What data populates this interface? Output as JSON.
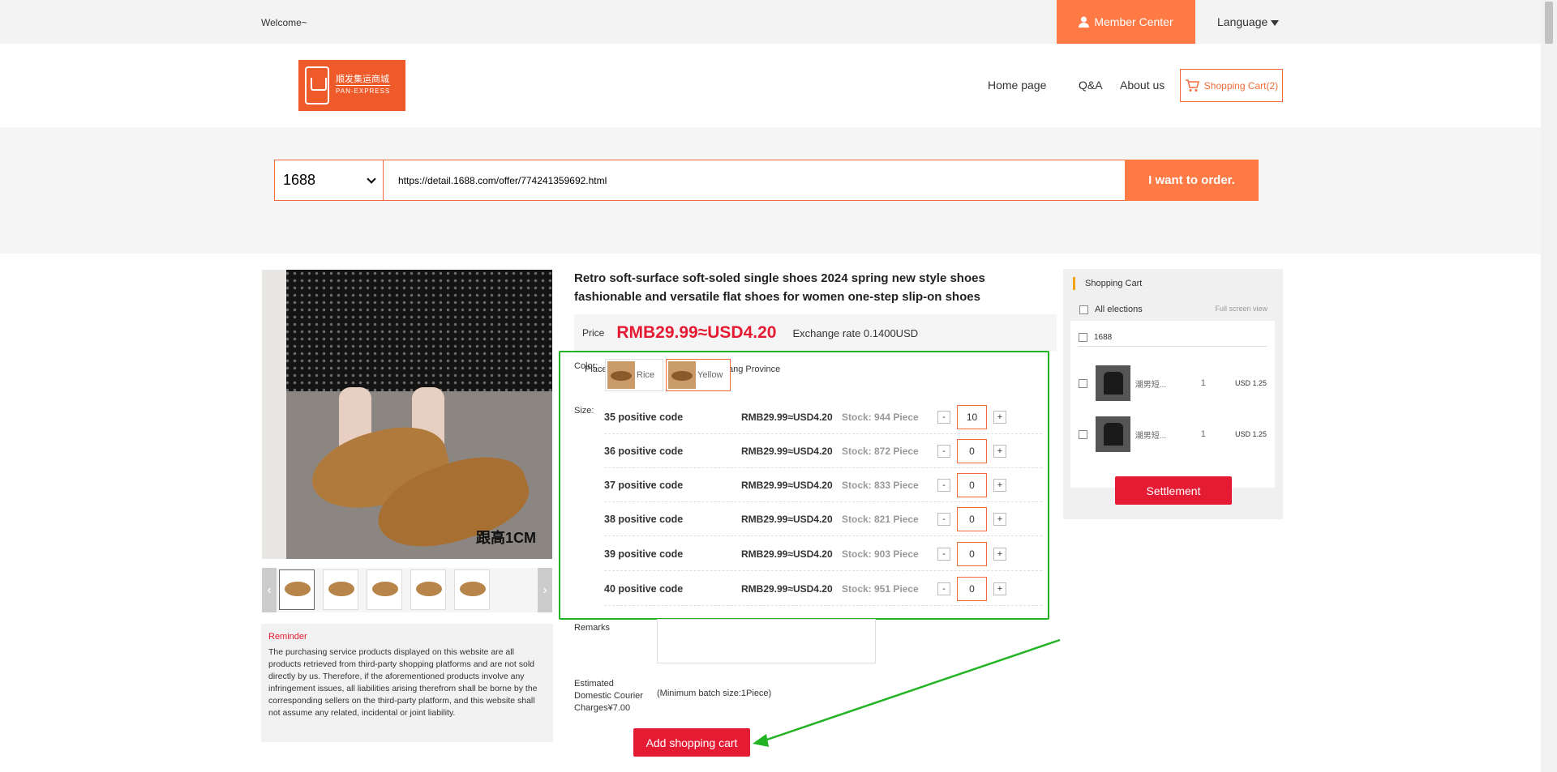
{
  "topbar": {
    "welcome": "Welcome~",
    "member_center": "Member Center",
    "language": "Language"
  },
  "header": {
    "logo_text": "顺发集运商城",
    "logo_sub": "PAN-EXPRESS",
    "nav": [
      "Home page",
      "Q&A",
      "About us"
    ],
    "cart": "Shopping Cart(2)"
  },
  "search": {
    "platform": "1688",
    "url": "https://detail.1688.com/offer/774241359692.html",
    "order_button": "I want to order."
  },
  "product": {
    "title": "Retro soft-surface soft-soled single shoes 2024 spring new style shoes fashionable and versatile flat shoes for women one-step slip-on shoes",
    "image_caption": "跟高1CM",
    "price_label": "Price",
    "price": "RMB29.99≈USD4.20",
    "exchange_rate": "Exchange rate 0.1400USD",
    "place_label": "Place",
    "color_label": "Color:",
    "province": "ang Province",
    "colors": [
      {
        "label": "Rice"
      },
      {
        "label": "Yellow"
      }
    ],
    "size_label": "Size:",
    "sizes": [
      {
        "name": "35 positive code",
        "price": "RMB29.99≈USD4.20",
        "stock": "Stock: 944 Piece",
        "qty": "10"
      },
      {
        "name": "36 positive code",
        "price": "RMB29.99≈USD4.20",
        "stock": "Stock: 872 Piece",
        "qty": "0"
      },
      {
        "name": "37 positive code",
        "price": "RMB29.99≈USD4.20",
        "stock": "Stock: 833 Piece",
        "qty": "0"
      },
      {
        "name": "38 positive code",
        "price": "RMB29.99≈USD4.20",
        "stock": "Stock: 821 Piece",
        "qty": "0"
      },
      {
        "name": "39 positive code",
        "price": "RMB29.99≈USD4.20",
        "stock": "Stock: 903 Piece",
        "qty": "0"
      },
      {
        "name": "40 positive code",
        "price": "RMB29.99≈USD4.20",
        "stock": "Stock: 951 Piece",
        "qty": "0"
      }
    ],
    "minus": "-",
    "plus": "+",
    "remarks_label": "Remarks",
    "estimated_label": [
      "Estimated",
      "Domestic Courier",
      "Charges¥7.00"
    ],
    "min_batch": "(Minimum batch size:1Piece)",
    "add_cart": "Add shopping cart"
  },
  "thumbs": {
    "prev": "‹",
    "next": "›"
  },
  "reminder": {
    "title": "Reminder",
    "body": "The purchasing service products displayed on this website are all products retrieved from third-party shopping platforms and are not sold directly by us. Therefore, if the aforementioned products involve any infringement issues, all liabilities arising therefrom shall be borne by the corresponding sellers on the third-party platform, and this website shall not assume any related, incidental or joint liability."
  },
  "cart_panel": {
    "title": "Shopping Cart",
    "all_select": "All elections",
    "full_screen": "Full screen view",
    "group": "1688",
    "items": [
      {
        "name": "潮男短...",
        "qty": "1",
        "price": "USD 1.25"
      },
      {
        "name": "潮男短...",
        "qty": "1",
        "price": "USD 1.25"
      }
    ],
    "settlement": "Settlement"
  },
  "colors": {
    "accent": "#ff7a45",
    "red": "#e41b33",
    "highlight_box": "#22b322"
  }
}
